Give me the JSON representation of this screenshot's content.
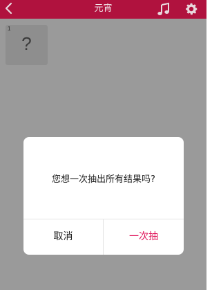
{
  "header": {
    "back_icon": "chevron-left-icon",
    "title": "元宵",
    "music_icon": "music-note-icon",
    "settings_icon": "gear-icon"
  },
  "cards": [
    {
      "index": "1",
      "symbol": "?"
    }
  ],
  "dialog": {
    "message": "您想一次抽出所有结果吗?",
    "cancel_label": "取消",
    "confirm_label": "一次抽",
    "confirm_color": "#e0145a"
  },
  "colors": {
    "header_bg": "#b0123e",
    "overlay_bg": "#9a9a9a"
  }
}
